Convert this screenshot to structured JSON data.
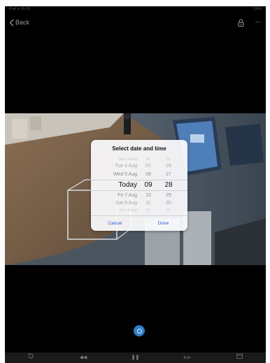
{
  "status_bar": {
    "left": "iPad ✈ 09:28",
    "right": "100%"
  },
  "nav": {
    "back_label": "Back"
  },
  "picker": {
    "title": "Select date and time",
    "rows": [
      {
        "day": "Mon 3 Aug",
        "hour": "06",
        "min": "25",
        "style": "faint"
      },
      {
        "day": "Tue 4 Aug",
        "hour": "07",
        "min": "26",
        "style": "mid"
      },
      {
        "day": "Wed 5 Aug",
        "hour": "08",
        "min": "27",
        "style": "near"
      },
      {
        "day": "Today",
        "hour": "09",
        "min": "28",
        "style": "selected"
      },
      {
        "day": "Fri 7 Aug",
        "hour": "10",
        "min": "29",
        "style": "near"
      },
      {
        "day": "Sat 8 Aug",
        "hour": "11",
        "min": "30",
        "style": "mid"
      },
      {
        "day": "Sun 9 Aug",
        "hour": "12",
        "min": "31",
        "style": "faint"
      }
    ],
    "cancel_label": "Cancel",
    "done_label": "Done"
  },
  "toolbar": {
    "rotate_icon": "rotate-icon",
    "rewind_label": "◀◀",
    "pause_label": "❚❚",
    "forward_label": "▶▶",
    "calendar_icon": "calendar-icon"
  },
  "colors": {
    "accent": "#2a5bd7",
    "capture": "#2f7fc4"
  }
}
